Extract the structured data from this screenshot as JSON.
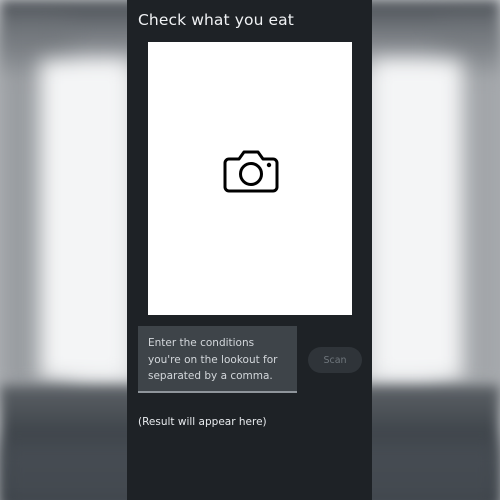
{
  "app": {
    "title": "Check what you eat"
  },
  "camera": {
    "icon": "camera-icon"
  },
  "conditions": {
    "placeholder": "Enter the conditions you're on the lookout for separated by a comma.",
    "value": ""
  },
  "scan": {
    "label": "Scan",
    "enabled": false
  },
  "result": {
    "text": "(Result will appear here)"
  },
  "colors": {
    "screen_background": "#1e2226",
    "input_background": "#3e4449",
    "scan_button_background": "#2f3439",
    "scan_button_text": "#6f767c",
    "preview_background": "#ffffff"
  }
}
